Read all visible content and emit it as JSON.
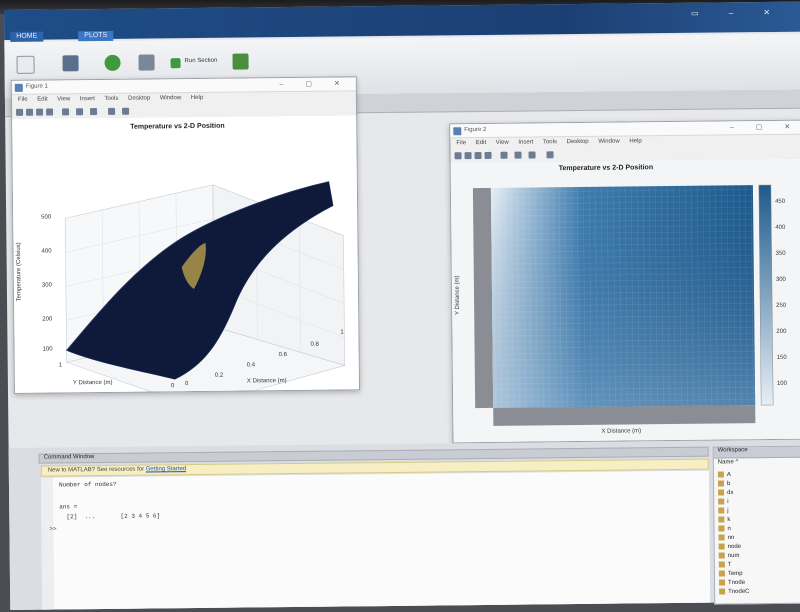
{
  "app": {
    "tabs": [
      "HOME",
      "PLOTS"
    ],
    "ribbon": {
      "run_section_label": "Run Section"
    }
  },
  "figure1": {
    "window_title": "Figure 1",
    "menu": [
      "File",
      "Edit",
      "View",
      "Insert",
      "Tools",
      "Desktop",
      "Window",
      "Help"
    ],
    "plot": {
      "title": "Temperature vs 2-D Position",
      "zlabel": "Temperature (Celsius)",
      "xlabel": "X Distance (m)",
      "ylabel": "Y Distance (m)",
      "z_ticks": [
        "100",
        "200",
        "300",
        "400",
        "500"
      ],
      "x_ticks": [
        "0",
        "0.2",
        "0.4",
        "0.6",
        "0.8",
        "1"
      ],
      "y_ticks": [
        "0",
        "1"
      ]
    }
  },
  "figure2": {
    "window_title": "Figure 2",
    "menu": [
      "File",
      "Edit",
      "View",
      "Insert",
      "Tools",
      "Desktop",
      "Window",
      "Help"
    ],
    "plot": {
      "title": "Temperature vs 2-D Position",
      "xlabel": "X Distance (m)",
      "ylabel": "Y Distance (m)",
      "colorbar_ticks": [
        "450",
        "400",
        "350",
        "300",
        "250",
        "200",
        "150",
        "100"
      ]
    }
  },
  "command_window": {
    "header": "Command Window",
    "notice_prefix": "New to MATLAB? See resources for",
    "notice_link": "Getting Started",
    "lines": [
      "Number of nodes?",
      "",
      "ans =",
      "  [2]  ...       [2 3 4 5 6]",
      ">>"
    ]
  },
  "workspace": {
    "header": "Workspace",
    "col_name": "Name ^",
    "items": [
      "A",
      "b",
      "dx",
      "i",
      "j",
      "k",
      "n",
      "nn",
      "node",
      "num",
      "T",
      "Temp",
      "Tnode",
      "TnodeC"
    ]
  },
  "colors": {
    "title_bar": "#1f4d87",
    "surface_dark": "#0f1a3a",
    "heatmap_light": "#c9dbea",
    "heatmap_dark": "#1f5a8c"
  }
}
